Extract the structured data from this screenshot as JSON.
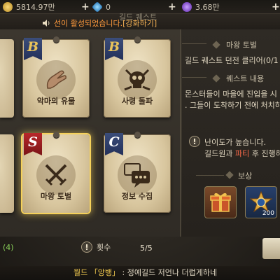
{
  "currency": {
    "gold": "5814.97만",
    "gems": "0",
    "purple": "3.68만",
    "gold_color": "#e0b64a",
    "gem_color": "#3aa8e8",
    "purple_color": "#8a4fd8"
  },
  "header": {
    "title_partial": "길드 퀘스트"
  },
  "notice": {
    "text": "선이 활성되었습니다. ",
    "link": "[강화하기]"
  },
  "cards": [
    {
      "rank": "B",
      "label": "악마의 유물",
      "icon": "hand-icon"
    },
    {
      "rank": "B",
      "label": "사령 돌파",
      "icon": "skull-icon"
    },
    {
      "rank": "S",
      "label": "마왕 토벌",
      "icon": "crossed-swords-icon",
      "selected": true
    },
    {
      "rank": "C",
      "label": "정보 수집",
      "icon": "speech-bubble-icon"
    }
  ],
  "left_footer": {
    "progress_partial": "(4)",
    "count_label": "횟수",
    "count_value": "5/5"
  },
  "detail": {
    "quest_title": "마왕 토벌",
    "quest_goal": "길드 퀘스트 던전 클리어(0/1",
    "content_head": "퀘스트 내용",
    "content_line1": "몬스터들이 마을에 진입을 시",
    "content_line2": ". 그들이 도착하기 전에 처치하",
    "difficulty_line1": "난이도가 높습니다.",
    "difficulty_line2_a": "길드원과 ",
    "difficulty_line2_b": "파티",
    "difficulty_line2_c": " 후 진행하",
    "reward_head": "보상",
    "rewards": [
      {
        "icon": "gift-box-icon",
        "count": ""
      },
      {
        "icon": "star-medal-icon",
        "count": "200"
      }
    ]
  },
  "chat": {
    "channel": "월드",
    "name": "「앙뱅」",
    "message": ": 정예길드 저언나 더럽게하네"
  }
}
